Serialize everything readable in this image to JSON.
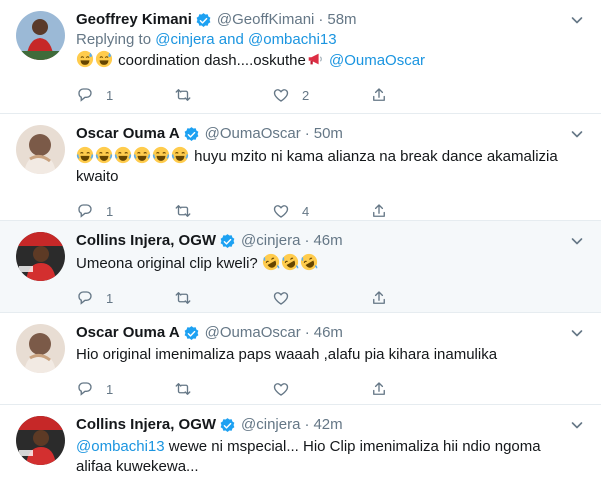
{
  "colors": {
    "link": "#1b95e0",
    "muted": "#657786",
    "verified": "#1da1f2",
    "highlight_bg": "#f5f8fa"
  },
  "icons": {
    "reply": "reply-icon",
    "retweet": "retweet-icon",
    "like": "like-icon",
    "share": "share-icon",
    "verified": "verified-badge-icon",
    "caret": "chevron-down-icon"
  },
  "tweets": [
    {
      "name": "Geoffrey Kimani",
      "handle": "@GeoffKimani",
      "time": "58m",
      "replying_prefix": "Replying to ",
      "replying_users": "@cinjera and @ombachi13",
      "text": "coordination dash....oskuthe",
      "mention": "@OumaOscar",
      "reply_count": "1",
      "retweet_count": "",
      "like_count": "2"
    },
    {
      "name": "Oscar Ouma A",
      "handle": "@OumaOscar",
      "time": "50m",
      "text": "huyu mzito ni kama alianza na break dance akamalizia kwaito",
      "reply_count": "1",
      "retweet_count": "",
      "like_count": "4"
    },
    {
      "name": "Collins Injera, OGW",
      "handle": "@cinjera",
      "time": "46m",
      "text": "Umeona original clip kweli?",
      "reply_count": "1",
      "retweet_count": "",
      "like_count": ""
    },
    {
      "name": "Oscar Ouma A",
      "handle": "@OumaOscar",
      "time": "46m",
      "text": "Hio original imenimaliza paps waaah ,alafu pia kihara inamulika",
      "reply_count": "1",
      "retweet_count": "",
      "like_count": ""
    },
    {
      "name": "Collins Injera, OGW",
      "handle": "@cinjera",
      "time": "42m",
      "mention": "@ombachi13",
      "text": "wewe ni mspecial... Hio Clip imenimaliza hii ndio ngoma alifaa kuwekewa...",
      "reply_count": "",
      "retweet_count": "",
      "like_count": ""
    }
  ]
}
